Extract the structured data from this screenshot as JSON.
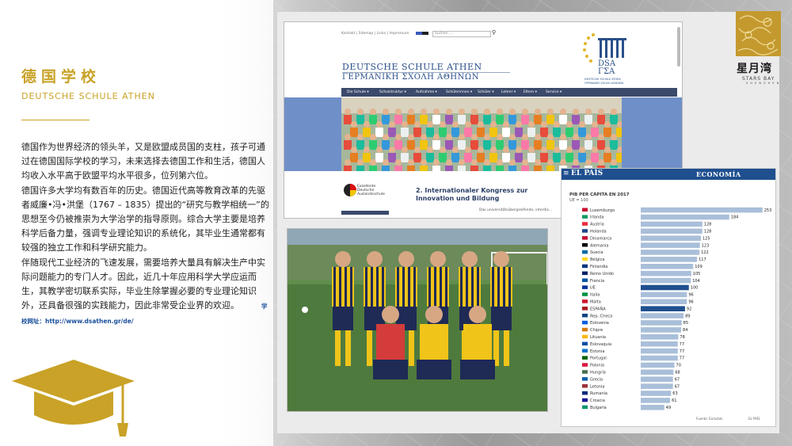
{
  "header": {
    "title_cn": "德国学校",
    "title_en": "DEUTSCHE SCHULE ATHEN"
  },
  "body": {
    "p1": "德国作为世界经济的领头羊，又是欧盟成员国的支柱，孩子可通过在德国国际学校的学习，未来选择去德国工作和生活，德国人均收入水平高于欧盟平均水平很多，位列第六位。",
    "p2": "德国许多大学均有数百年的历史。德国近代高等教育改革的先驱者威廉•冯•洪堡（1767 – 1835）提出的“研究与教学相统一”的思想至今仍被推崇为大学治学的指导原则。综合大学主要是培养科学后备力量，强调专业理论知识的系统化，其毕业生通常都有较强的独立工作和科学研究能力。",
    "p3": "伴随现代工业经济的飞速发展，需要培养大量具有解决生产中实际问题能力的专门人才。因此，近几十年应用科学大学应运而生，其教学密切联系实际，毕业生除掌握必要的专业理论知识外，还具备很强的实践能力，因此非常受企业界的欢迎。",
    "url_label": "学校网址：http://www.dsathen.gr/de/"
  },
  "logo": {
    "name_cn": "星月湾",
    "name_en": "STARS BAY",
    "tagline": "S H E N Z H E N"
  },
  "website": {
    "top_links": "Kontakt  |  Sitemap  |  Links  |  Impressum",
    "search_placeholder": "Suchen ...",
    "school_name_de": "DEUTSCHE SCHULE ATHEN",
    "school_name_gr": "ΓΕΡΜΑΝΙΚΗ ΣΧΟΛΗ ΑΘΗΝΩΝ",
    "dsa_logo_text": "DSA",
    "dsa_logo_text2": "ΓΣΑ",
    "dsa_caption": "DEUTSCHE SCHULE ATHEN",
    "dsa_caption2": "ΓΕΡΜΑΝΙΚΗ ΣΧΟΛΗ ΑΘΗΝΩΝ",
    "nav": [
      "Die Schule ▾",
      "Schulstruktur ▾",
      "Aufnahme ▾",
      "Schülerinnen ▾",
      "Schüler ▾",
      "Lehrer ▾",
      "Eltern ▾",
      "Service ▾"
    ],
    "excellence": [
      "Exzellente",
      "Deutsche",
      "Auslandsschule"
    ],
    "headline": "2. Internationaler Kongress zur Innovation und Bildung",
    "subline": "Das universitätsübergreifende, interdis..."
  },
  "chart_data": {
    "type": "bar",
    "title": "PIB PER CÁPITA EN 2017",
    "subtitle": "UE = 100",
    "masthead": "EL PAÍS",
    "section": "ECONOMÍA",
    "source": "Fuente: Eurostat.",
    "credit": "EL PAÍS",
    "categories": [
      "Luxemburgo",
      "Irlanda",
      "Austria",
      "Holanda",
      "Dinamarca",
      "Alemania",
      "Suecia",
      "Bélgica",
      "Finlandia",
      "Reino Unido",
      "Francia",
      "UE",
      "Italia",
      "Malta",
      "ESPAÑA",
      "Rep. Checa",
      "Eslovenia",
      "Chipre",
      "Lituania",
      "Eslovaquia",
      "Estonia",
      "Portugal",
      "Polonia",
      "Hungría",
      "Grecia",
      "Letonia",
      "Rumanía",
      "Croacia",
      "Bulgaria"
    ],
    "values": [
      253,
      184,
      128,
      128,
      125,
      123,
      122,
      117,
      109,
      105,
      104,
      100,
      96,
      96,
      92,
      89,
      85,
      84,
      78,
      77,
      77,
      77,
      70,
      68,
      67,
      67,
      63,
      61,
      49
    ],
    "highlight": [
      "UE",
      "ESPAÑA"
    ],
    "xlim": [
      0,
      260
    ],
    "colors": {
      "bar": "#a9bfd9",
      "highlight": "#1f4f8f"
    }
  }
}
